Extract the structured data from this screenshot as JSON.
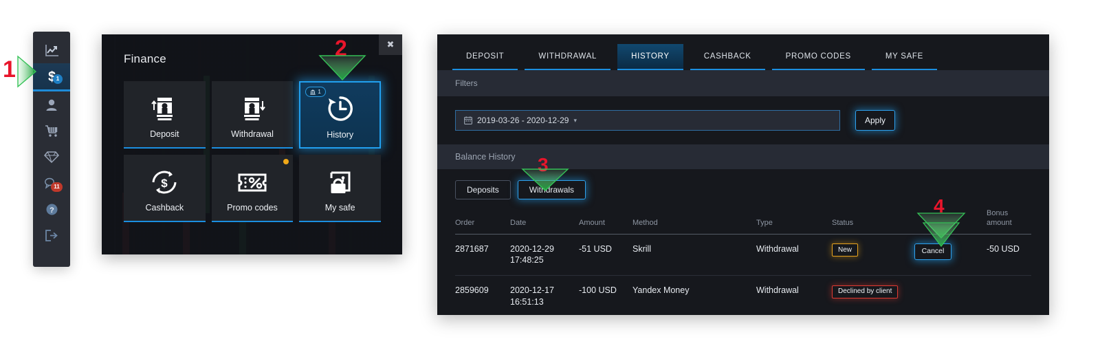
{
  "sidebar": {
    "items": [
      {
        "name": "chart-icon",
        "badge": null,
        "active": false
      },
      {
        "name": "finance-icon",
        "badge": "1",
        "active": true
      },
      {
        "name": "profile-icon",
        "badge": null,
        "active": false
      },
      {
        "name": "cart-icon",
        "badge": null,
        "active": false
      },
      {
        "name": "diamond-icon",
        "badge": null,
        "active": false
      },
      {
        "name": "chat-icon",
        "badge": "11",
        "active": false
      },
      {
        "name": "help-icon",
        "badge": null,
        "active": false
      },
      {
        "name": "logout-icon",
        "badge": null,
        "active": false
      }
    ]
  },
  "finance": {
    "title": "Finance",
    "close_label": "✖",
    "tiles": [
      {
        "label": "Deposit",
        "icon": "deposit-icon",
        "selected": false,
        "badge": null,
        "dot": false
      },
      {
        "label": "Withdrawal",
        "icon": "withdrawal-icon",
        "selected": false,
        "badge": null,
        "dot": false
      },
      {
        "label": "History",
        "icon": "history-icon",
        "selected": true,
        "badge": "1",
        "dot": false
      },
      {
        "label": "Cashback",
        "icon": "cashback-icon",
        "selected": false,
        "badge": null,
        "dot": false
      },
      {
        "label": "Promo codes",
        "icon": "promo-codes-icon",
        "selected": false,
        "badge": null,
        "dot": true
      },
      {
        "label": "My safe",
        "icon": "my-safe-icon",
        "selected": false,
        "badge": null,
        "dot": false
      }
    ]
  },
  "panel": {
    "tabs": [
      {
        "label": "DEPOSIT",
        "active": false
      },
      {
        "label": "WITHDRAWAL",
        "active": false
      },
      {
        "label": "HISTORY",
        "active": true
      },
      {
        "label": "CASHBACK",
        "active": false
      },
      {
        "label": "PROMO CODES",
        "active": false
      },
      {
        "label": "MY SAFE",
        "active": false
      }
    ],
    "filters_label": "Filters",
    "date_range": "2019-03-26 - 2020-12-29",
    "date_caret": "▾",
    "apply_label": "Apply",
    "balance_history_label": "Balance History",
    "segments": [
      {
        "label": "Deposits",
        "active": false
      },
      {
        "label": "Withdrawals",
        "active": true
      }
    ],
    "table": {
      "columns": [
        "Order",
        "Date",
        "Amount",
        "Method",
        "Type",
        "Status",
        "",
        "Bonus amount"
      ],
      "rows": [
        {
          "order": "2871687",
          "date": "2020-12-29 17:48:25",
          "amount": "-51 USD",
          "method": "Skrill",
          "type": "Withdrawal",
          "status": "New",
          "status_kind": "new",
          "action": "Cancel",
          "bonus": "-50 USD"
        },
        {
          "order": "2859609",
          "date": "2020-12-17 16:51:13",
          "amount": "-100 USD",
          "method": "Yandex Money",
          "type": "Withdrawal",
          "status": "Declined by client",
          "status_kind": "declined",
          "action": "",
          "bonus": ""
        }
      ]
    }
  },
  "markers": [
    {
      "number": "1",
      "direction": "right"
    },
    {
      "number": "2",
      "direction": "down"
    },
    {
      "number": "3",
      "direction": "down"
    },
    {
      "number": "4",
      "direction": "down"
    }
  ],
  "colors": {
    "accent_blue": "#1b8fe0",
    "glow_blue": "#2ea2ef",
    "marker_red": "#e8152b",
    "arrow_green": "#1ea33a",
    "status_new": "#e8a31d",
    "status_declined": "#e03a32",
    "promo_dot": "#f0a818",
    "badge_red": "#c0392b"
  }
}
